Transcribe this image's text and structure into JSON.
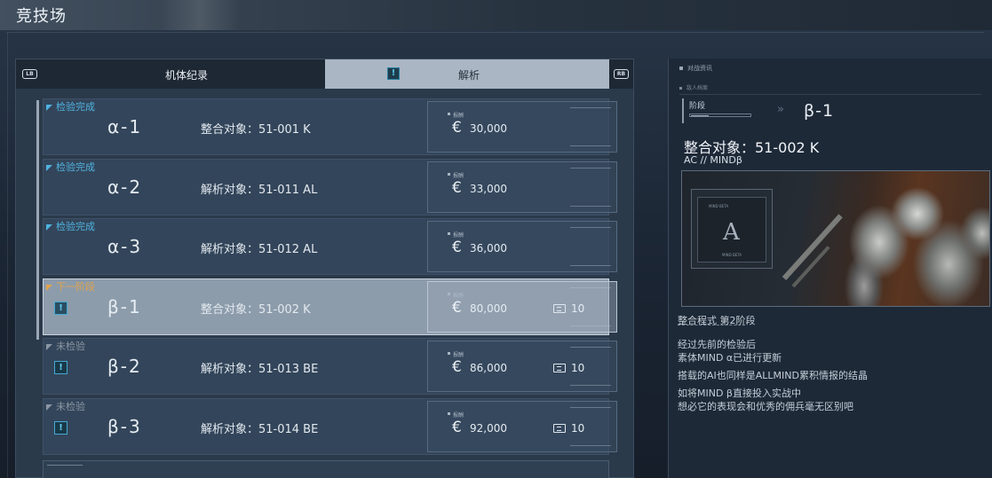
{
  "page": {
    "title": "竞技场"
  },
  "tabs": {
    "left_key": "LB",
    "left_label": "机体纪录",
    "right_alert": "!",
    "right_label": "解析",
    "right_key": "RB"
  },
  "reward_tag": "报酬",
  "stages": [
    {
      "status": "检验完成",
      "status_type": "done",
      "alert": "",
      "code": "α-1",
      "target": "整合对象：51-001 K",
      "reward": "30,000",
      "tickets": ""
    },
    {
      "status": "检验完成",
      "status_type": "done",
      "alert": "",
      "code": "α-2",
      "target": "解析对象：51-011 AL",
      "reward": "33,000",
      "tickets": ""
    },
    {
      "status": "检验完成",
      "status_type": "done",
      "alert": "",
      "code": "α-3",
      "target": "解析对象：51-012 AL",
      "reward": "36,000",
      "tickets": ""
    },
    {
      "status": "下一阶段",
      "status_type": "next",
      "alert": "!",
      "code": "β-1",
      "target": "整合对象：51-002 K",
      "reward": "80,000",
      "tickets": "10",
      "selected": true
    },
    {
      "status": "未检验",
      "status_type": "pending",
      "alert": "!",
      "code": "β-2",
      "target": "解析对象：51-013 BE",
      "reward": "86,000",
      "tickets": "10"
    },
    {
      "status": "未检验",
      "status_type": "pending",
      "alert": "!",
      "code": "β-3",
      "target": "解析对象：51-014 BE",
      "reward": "92,000",
      "tickets": "10"
    }
  ],
  "detail": {
    "header1": "对战资讯",
    "header2": "敌人档案",
    "stage_label": "阶段",
    "stage_code": "β-1",
    "target": "整合对象：51-002 K",
    "ac_line": "AC //    MINDβ",
    "preview_screen_text": "MIND BETA",
    "preview_logo": "A",
    "preview_logo_sub": "MIND BETA",
    "program": "整合程式    第2阶段",
    "desc": [
      "经过先前的检验后",
      "素体MIND α已进行更新",
      "",
      "搭载的AI也同样是ALLMIND累积情报的结晶",
      "",
      "如将MIND β直接投入实战中",
      "想必它的表现会和优秀的佣兵毫无区别吧"
    ]
  },
  "colors": {
    "status_done": "#4fb3e0",
    "status_next": "#e0a24d",
    "status_pending": "#8a96a3",
    "alert_accent": "#61cdf2"
  },
  "icons": {
    "coin": "€",
    "chevron": "»"
  }
}
